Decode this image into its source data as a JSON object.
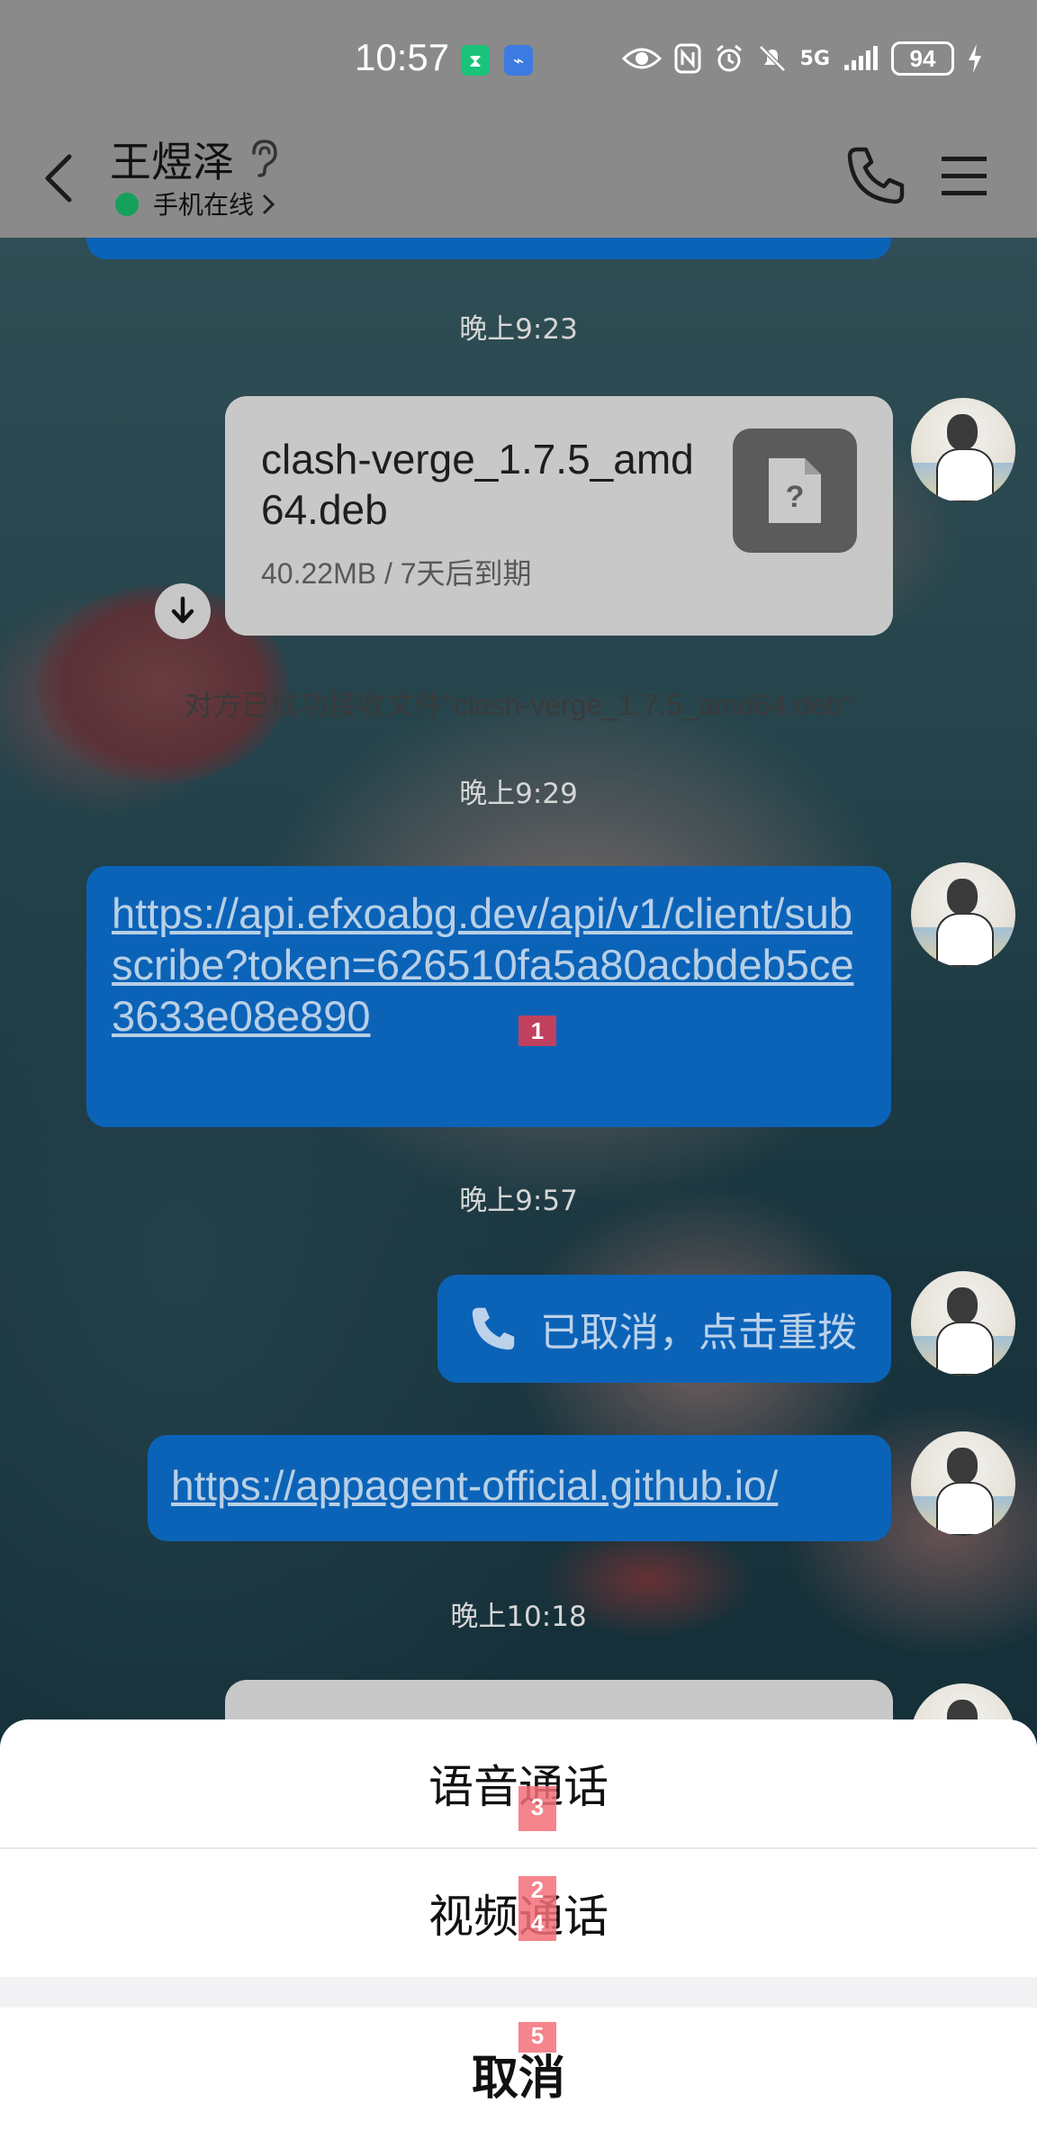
{
  "status_bar": {
    "time": "10:57",
    "network": "5G",
    "battery": "94"
  },
  "header": {
    "contact_name": "王煜泽",
    "online_status": "手机在线"
  },
  "messages": {
    "timestamp_1": "晚上9:23",
    "file": {
      "name": "clash-verge_1.7.5_amd64.deb",
      "meta": "40.22MB / 7天后到期"
    },
    "file_received_note": "对方已成功接收文件\"clash-verge_1.7.5_amd64.deb\"",
    "timestamp_2": "晚上9:29",
    "link_1": "https://api.efxoabg.dev/api/v1/client/subscribe?token=626510fa5a80acbdeb5ce3633e08e890",
    "timestamp_3": "晚上9:57",
    "call_status": "已取消，点击重拨",
    "link_2": "https://appagent-official.github.io/",
    "timestamp_4": "晚上10:18"
  },
  "action_sheet": {
    "voice_call": "语音通话",
    "video_call": "视频通话",
    "cancel": "取消"
  },
  "markers": {
    "m1": "1",
    "m2": "2",
    "m3": "3",
    "m4": "4",
    "m5": "5"
  },
  "colors": {
    "bubble": "#0b63b8",
    "online": "#15a05c",
    "marker": "#e23a4e"
  },
  "icons": [
    "back-arrow-icon",
    "ear-icon",
    "chevron-right-icon",
    "phone-icon",
    "menu-icon",
    "file-unknown-icon",
    "download-icon",
    "user-avatar"
  ]
}
